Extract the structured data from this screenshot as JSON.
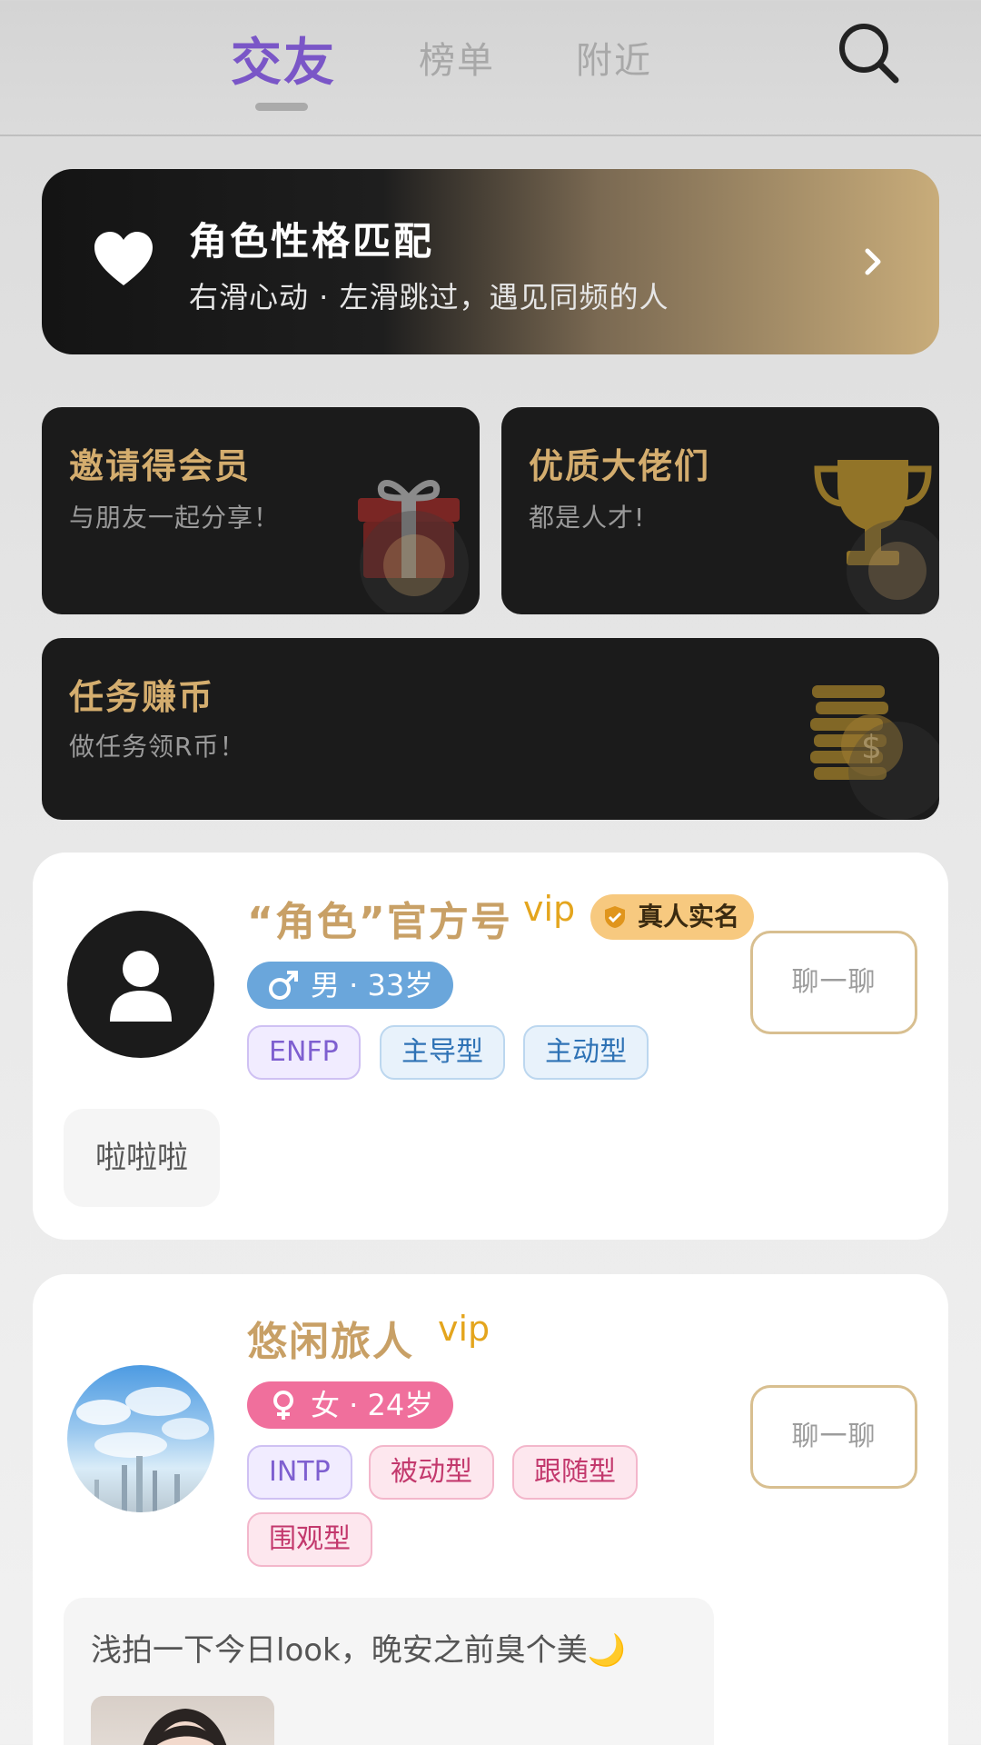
{
  "nav": {
    "tabs": [
      {
        "label": "交友",
        "active": true
      },
      {
        "label": "榜单",
        "active": false
      },
      {
        "label": "附近",
        "active": false
      }
    ],
    "search_icon": "search-icon"
  },
  "banner": {
    "title": "角色性格匹配",
    "subtitle": "右滑心动 · 左滑跳过，遇见同频的人",
    "icon": "heart-icon"
  },
  "features": [
    {
      "title": "邀请得会员",
      "subtitle": "与朋友一起分享！",
      "icon": "gift-icon"
    },
    {
      "title": "优质大佬们",
      "subtitle": "都是人才!",
      "icon": "trophy-icon"
    },
    {
      "title": "任务赚币",
      "subtitle": "做任务领R币！",
      "icon": "coins-icon"
    }
  ],
  "users": [
    {
      "name": "“角色”官方号",
      "vip": "vip",
      "verified": "真人实名",
      "gender": "男 · 33岁",
      "tags": [
        "ENFP",
        "主导型",
        "主动型"
      ],
      "chat": "聊一聊",
      "post": "啦啦啦"
    },
    {
      "name": "悠闲旅人",
      "vip": "vip",
      "gender": "女 · 24岁",
      "tags": [
        "INTP",
        "被动型",
        "跟随型",
        "围观型"
      ],
      "chat": "聊一聊",
      "post": "浅拍一下今日look，晚安之前臭个美🌙"
    }
  ],
  "colors": {
    "accent": "#7a56c7",
    "gold": "#d4ad6e",
    "male": "#6aa6db",
    "female": "#f06f9c",
    "vip": "#e4a51d"
  }
}
